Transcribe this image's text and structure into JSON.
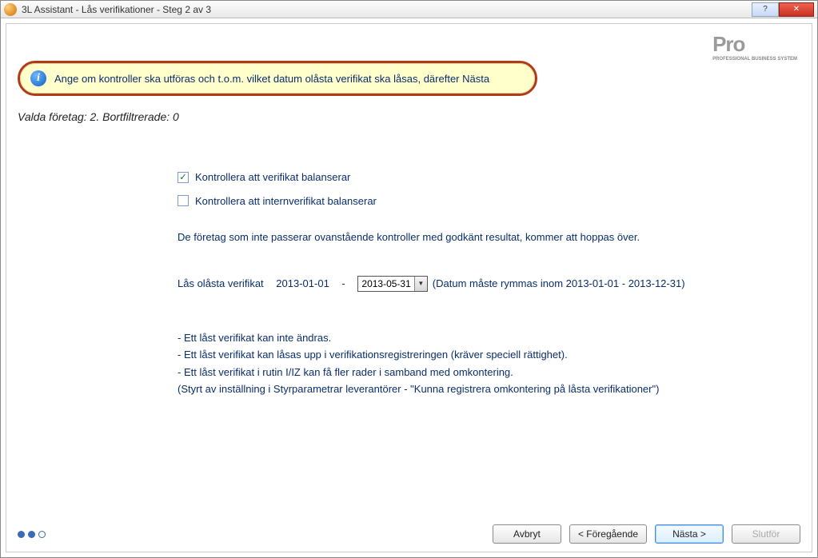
{
  "window": {
    "title": "3L Assistant - Lås verifikationer - Steg 2 av 3"
  },
  "logo": {
    "text": "Pro",
    "subtitle": "PROFESSIONAL BUSINESS SYSTEM"
  },
  "banner": {
    "text": "Ange om kontroller ska utföras och t.o.m. vilket datum olåsta verifikat ska låsas, därefter Nästa"
  },
  "status": {
    "text": "Valda företag: 2. Bortfiltrerade: 0"
  },
  "checkboxes": {
    "balance": {
      "label": "Kontrollera att verifikat balanserar",
      "checked": true
    },
    "intern_balance": {
      "label": "Kontrollera att internverifikat balanserar",
      "checked": false
    }
  },
  "explain": "De företag som inte passerar ovanstående kontroller med godkänt resultat, kommer att hoppas över.",
  "date_section": {
    "label": "Lås olåsta verifikat",
    "from": "2013-01-01",
    "sep": "-",
    "to": "2013-05-31",
    "hint": "(Datum måste rymmas inom 2013-01-01 - 2013-12-31)"
  },
  "notes": {
    "l1": "- Ett låst verifikat kan inte ändras.",
    "l2": "- Ett låst verifikat kan låsas upp i verifikationsregistreringen (kräver speciell rättighet).",
    "l3": "- Ett låst verifikat i rutin I/IZ kan få fler rader i samband med omkontering.",
    "l4": "(Styrt av inställning i Styrparametrar leverantörer - \"Kunna registrera omkontering på låsta verifikationer\")"
  },
  "buttons": {
    "cancel": "Avbryt",
    "prev": "< Föregående",
    "next": "Nästa >",
    "finish": "Slutför"
  },
  "titlebar_buttons": {
    "help": "?",
    "close": "✕"
  },
  "step": {
    "current": 2,
    "total": 3
  }
}
